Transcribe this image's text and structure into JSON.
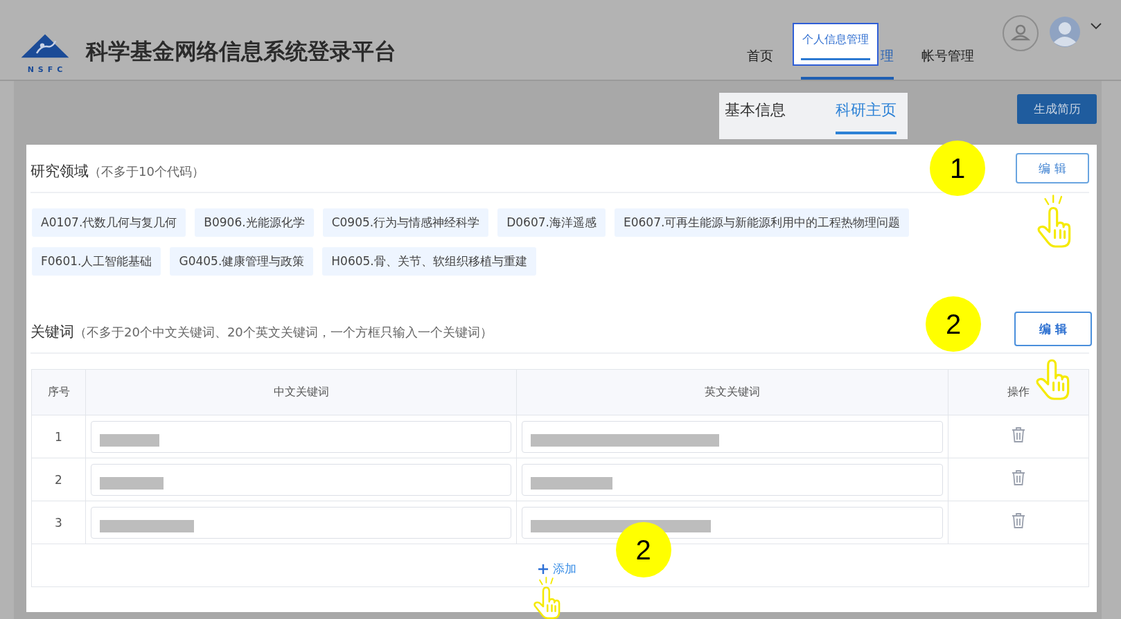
{
  "header": {
    "logo_text": "NSFC",
    "title": "科学基金网络信息系统登录平台",
    "nav": [
      {
        "label": "首页",
        "selected": false
      },
      {
        "label": "理",
        "selected": true,
        "spotlight": "个人信息管理"
      },
      {
        "label": "帐号管理",
        "selected": false
      }
    ]
  },
  "subtabs": [
    {
      "label": "基本信息",
      "selected": false
    },
    {
      "label": "科研主页",
      "selected": true
    }
  ],
  "resume_button": "生成简历",
  "sections": [
    {
      "kind": "tags",
      "title": "研究领域",
      "note": "（不多于10个代码）",
      "edit": "编 辑",
      "highlighted": false,
      "marker": "1",
      "tags": [
        "A0107.代数几何与复几何",
        "B0906.光能源化学",
        "C0905.行为与情感神经科学",
        "D0607.海洋遥感",
        "E0607.可再生能源与新能源利用中的工程热物理问题",
        "F0601.人工智能基础",
        "G0405.健康管理与政策",
        "H0605.骨、关节、软组织移植与重建"
      ]
    },
    {
      "kind": "table",
      "title": "关键词",
      "note": "（不多于20个中文关键词、20个英文关键词，一个方框只输入一个关键词）",
      "edit": "编 辑",
      "highlighted": true,
      "marker": "2",
      "columns": [
        "序号",
        "中文关键词",
        "英文关键词",
        "操作"
      ],
      "rows": [
        {
          "index": "1",
          "redacted": true
        },
        {
          "index": "2",
          "redacted": true
        },
        {
          "index": "3",
          "redacted": true
        }
      ],
      "add": "添加",
      "add_marker": "2"
    }
  ]
}
